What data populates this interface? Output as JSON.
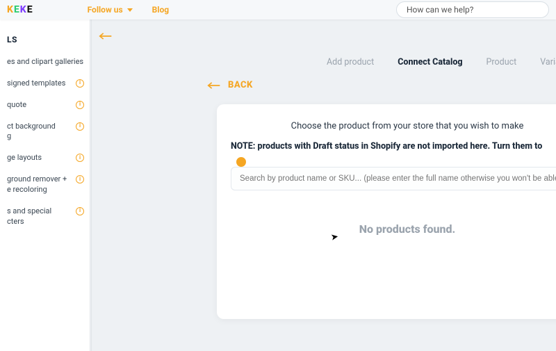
{
  "topbar": {
    "logo_chars": [
      "K",
      "E",
      "K",
      "E"
    ],
    "follow": "Follow us",
    "blog": "Blog",
    "search_placeholder": "How can we help?"
  },
  "sidebar": {
    "title": "LS",
    "items": [
      {
        "label": "es and clipart galleries",
        "info": false
      },
      {
        "label": "signed templates",
        "info": true
      },
      {
        "label": "quote",
        "info": true
      },
      {
        "label": "ct background\ng",
        "info": true
      },
      {
        "label": "ge layouts",
        "info": true
      },
      {
        "label": "ground remover +\ne recoloring",
        "info": true
      },
      {
        "label": "s and special\ncters",
        "info": true
      }
    ]
  },
  "collapse_arrow": "←",
  "steps": {
    "items": [
      {
        "label": "Add product",
        "active": false
      },
      {
        "label": "Connect Catalog",
        "active": true
      },
      {
        "label": "Product",
        "active": false
      },
      {
        "label": "Variatio",
        "active": false
      }
    ]
  },
  "back": {
    "label": "BACK"
  },
  "card": {
    "lead": "Choose the product from your store that you wish to make",
    "note": "NOTE: products with Draft status in Shopify are not imported here. Turn them to",
    "search_placeholder": "Search by product name or SKU... (please enter the full name otherwise you won't be able to find",
    "empty": "No products found."
  }
}
